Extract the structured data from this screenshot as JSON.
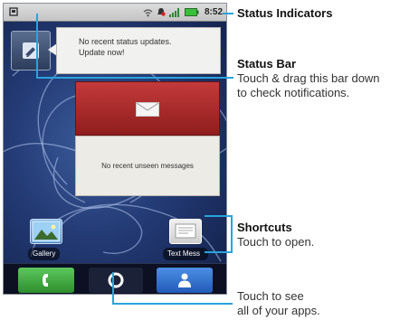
{
  "status_bar": {
    "time": "8:52"
  },
  "status_widget": {
    "line1": "No recent status updates.",
    "line2": "Update now!"
  },
  "messages_widget": {
    "text": "No recent unseen messages"
  },
  "shortcuts": [
    {
      "label": "Gallery",
      "icon": "gallery-icon"
    },
    {
      "label": "Text Mess",
      "icon": "text-messaging-icon"
    }
  ],
  "dock": {
    "left": "phone-icon",
    "center": "launcher-icon",
    "right": "contacts-icon"
  },
  "callouts": {
    "status_indicators": {
      "title": "Status Indicators"
    },
    "status_bar": {
      "title": "Status Bar",
      "line1": "Touch & drag this bar down",
      "line2": "to check notifications."
    },
    "shortcuts": {
      "title": "Shortcuts",
      "line1": "Touch to open."
    },
    "apps": {
      "line1": "Touch to see",
      "line2": "all of your apps."
    }
  },
  "colors": {
    "callout_line": "#29a3dd",
    "phone_button": "#3aa33a",
    "contacts_button": "#2d6fcf"
  }
}
